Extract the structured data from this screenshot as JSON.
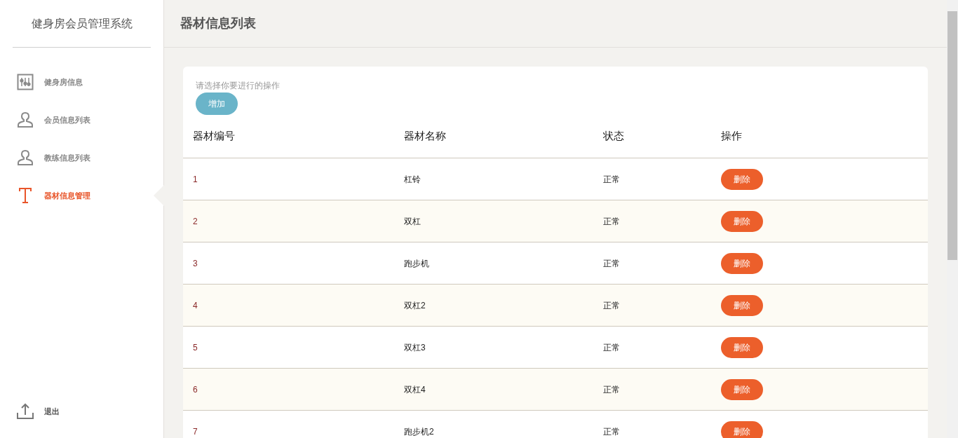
{
  "sidebar": {
    "title": "健身房会员管理系统",
    "items": [
      {
        "label": "健身房信息",
        "selected": false
      },
      {
        "label": "会员信息列表",
        "selected": false
      },
      {
        "label": "教练信息列表",
        "selected": false
      },
      {
        "label": "器材信息管理",
        "selected": true
      }
    ],
    "logout": "退出"
  },
  "header": {
    "title": "器材信息列表"
  },
  "panel": {
    "hint": "请选择你要进行的操作",
    "add_button": "增加",
    "table": {
      "columns": [
        "器材编号",
        "器材名称",
        "状态",
        "操作"
      ],
      "rows": [
        {
          "id": "1",
          "name": "杠铃",
          "status": "正常",
          "action": "删除"
        },
        {
          "id": "2",
          "name": "双杠",
          "status": "正常",
          "action": "删除"
        },
        {
          "id": "3",
          "name": "跑步机",
          "status": "正常",
          "action": "删除"
        },
        {
          "id": "4",
          "name": "双杠2",
          "status": "正常",
          "action": "删除"
        },
        {
          "id": "5",
          "name": "双杠3",
          "status": "正常",
          "action": "删除"
        },
        {
          "id": "6",
          "name": "双杠4",
          "status": "正常",
          "action": "删除"
        },
        {
          "id": "7",
          "name": "跑步机2",
          "status": "正常",
          "action": "删除"
        }
      ]
    }
  }
}
